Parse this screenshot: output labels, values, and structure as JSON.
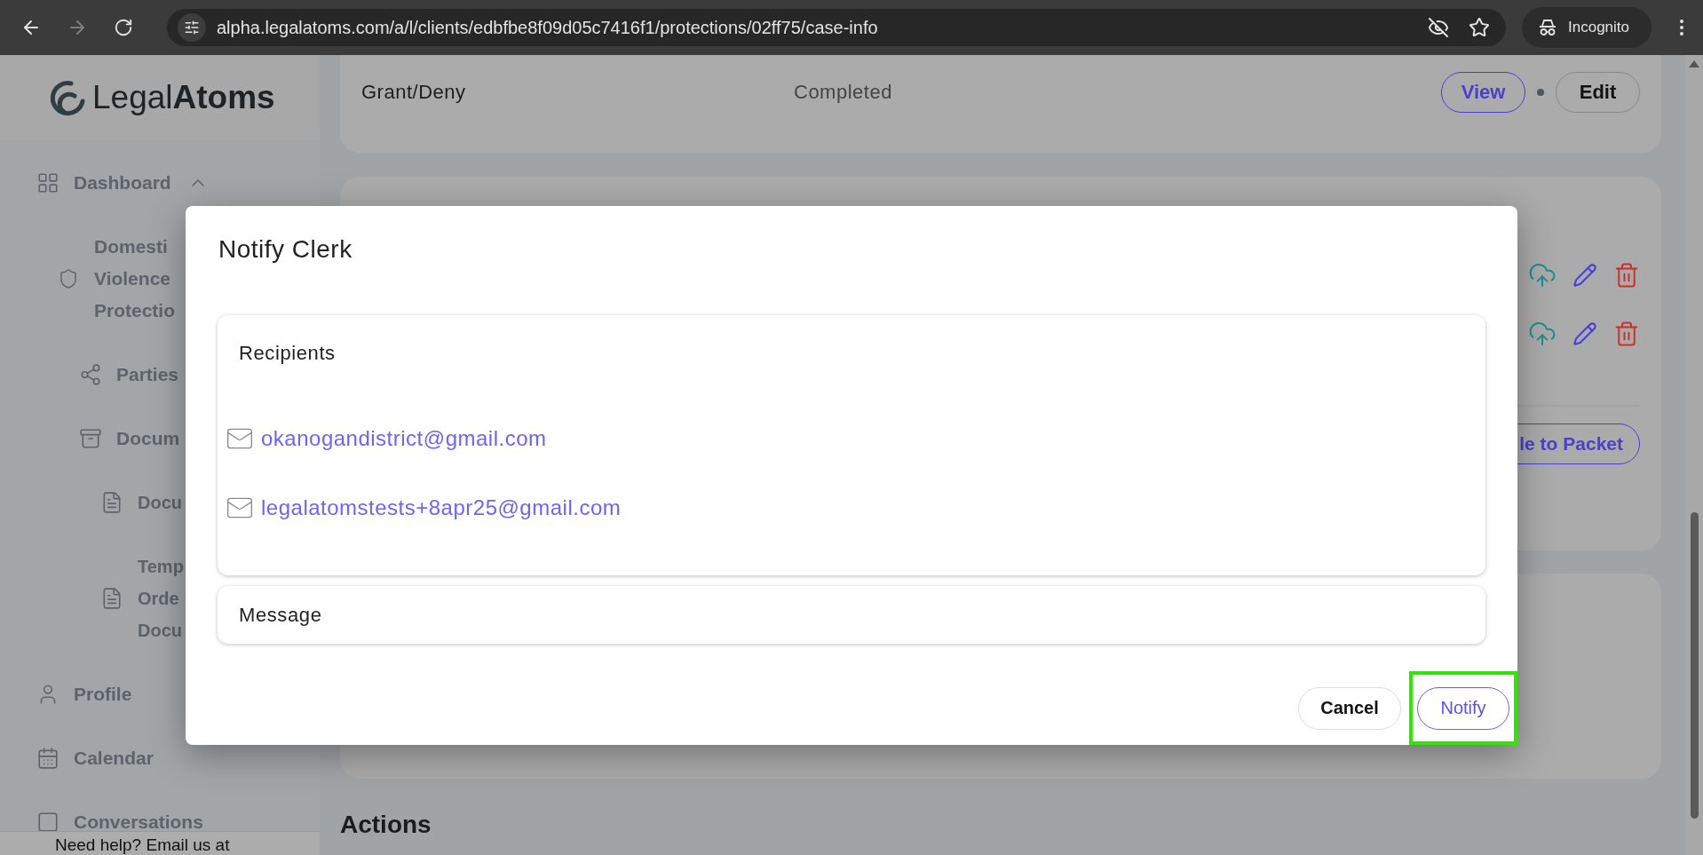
{
  "browser": {
    "url": "alpha.legalatoms.com/a/l/clients/edbfbe8f09d05c7416f1/protections/02ff75/case-info",
    "profile": "Incognito"
  },
  "sidebar": {
    "logo": "Legal**Atoms**",
    "items": [
      {
        "lines": [
          "Dashboard"
        ],
        "expanded": true,
        "children": [
          {
            "lines": [
              "Domesti",
              "Violence",
              "Protectio"
            ],
            "children": [
              {
                "lines": [
                  "Parties"
                ]
              },
              {
                "lines": [
                  "Docum"
                ],
                "children": [
                  {
                    "lines": [
                      "Docu"
                    ]
                  },
                  {
                    "lines": [
                      "Temp",
                      "Orde",
                      "Docu"
                    ]
                  }
                ]
              }
            ]
          }
        ]
      },
      {
        "lines": [
          "Profile"
        ]
      },
      {
        "lines": [
          "Calendar"
        ]
      },
      {
        "lines": [
          "Conversations"
        ]
      }
    ],
    "help": "Need help? Email us at"
  },
  "task": {
    "name": "Grant/Deny",
    "status": "Completed",
    "actions": [
      {
        "label": "View",
        "kind": "primary"
      },
      {
        "label": "Edit",
        "kind": "secondary"
      }
    ]
  },
  "packet_button": "le to Packet",
  "section_heading": "Actions",
  "dialog": {
    "title": "Notify Clerk",
    "recipients_label": "Recipients",
    "recipients": [
      "okanogandistrict@gmail.com",
      "legalatomstests+8apr25@gmail.com"
    ],
    "message_label": "Message",
    "buttons": [
      {
        "label": "Cancel",
        "kind": "secondary",
        "highlighted": false
      },
      {
        "label": "Notify",
        "kind": "primary",
        "highlighted": true
      }
    ]
  }
}
